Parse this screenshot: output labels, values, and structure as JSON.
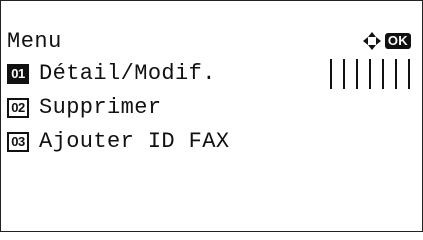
{
  "header": {
    "title": "Menu",
    "nav_icon": "four-way-arrow-icon",
    "ok_label": "OK"
  },
  "menu": {
    "selected_index": 0,
    "items": [
      {
        "number": "01",
        "label": "Détail/Modif."
      },
      {
        "number": "02",
        "label": "Supprimer"
      },
      {
        "number": "03",
        "label": "Ajouter ID FAX"
      }
    ]
  },
  "colors": {
    "foreground": "#111111",
    "background": "#ffffff"
  }
}
